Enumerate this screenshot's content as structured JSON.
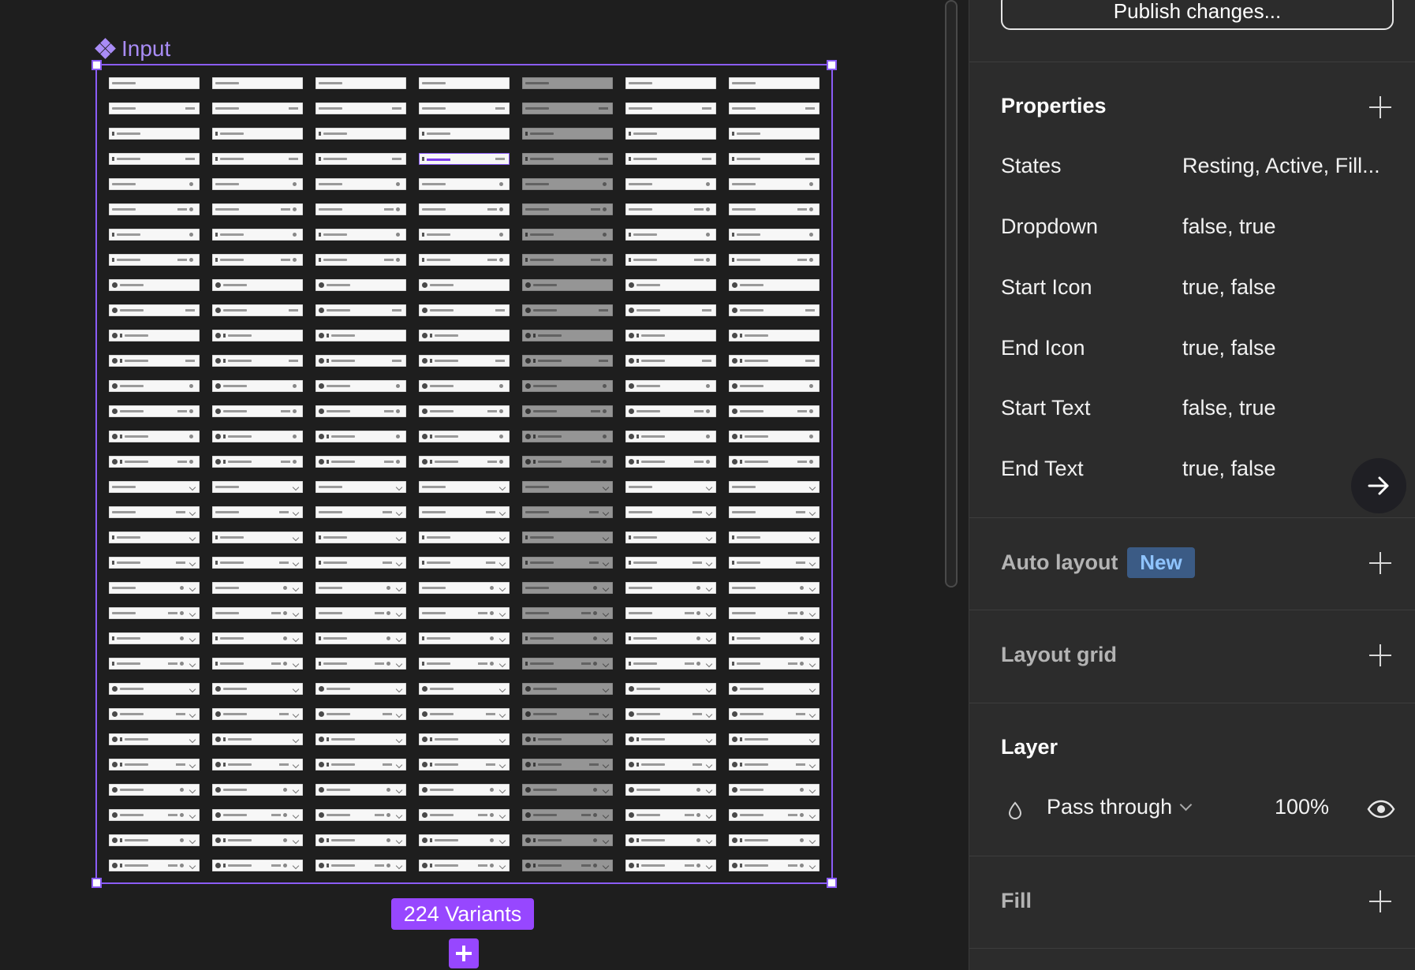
{
  "canvas": {
    "component_name": "Input",
    "variant_count_label": "224 Variants",
    "grid": {
      "columns": 7,
      "rows": 32
    }
  },
  "panel": {
    "publish_label": "Publish changes...",
    "properties": {
      "title": "Properties",
      "rows": [
        {
          "name": "States",
          "value": "Resting, Active, Fill..."
        },
        {
          "name": "Dropdown",
          "value": "false, true"
        },
        {
          "name": "Start Icon",
          "value": "true, false"
        },
        {
          "name": "End Icon",
          "value": "true, false"
        },
        {
          "name": "Start Text",
          "value": "false, true"
        },
        {
          "name": "End Text",
          "value": "true, false"
        }
      ]
    },
    "auto_layout": {
      "title": "Auto layout",
      "badge": "New"
    },
    "layout_grid": {
      "title": "Layout grid"
    },
    "layer": {
      "title": "Layer",
      "blend_mode": "Pass through",
      "opacity": "100%"
    },
    "fill": {
      "title": "Fill"
    }
  },
  "colors": {
    "canvas_bg": "#1e1e1e",
    "panel_bg": "#2c2c2c",
    "selection": "#8b5cf6",
    "variant_badge": "#9747ff",
    "new_badge_bg": "#3b5b85",
    "new_badge_text": "#8fc4ff"
  }
}
